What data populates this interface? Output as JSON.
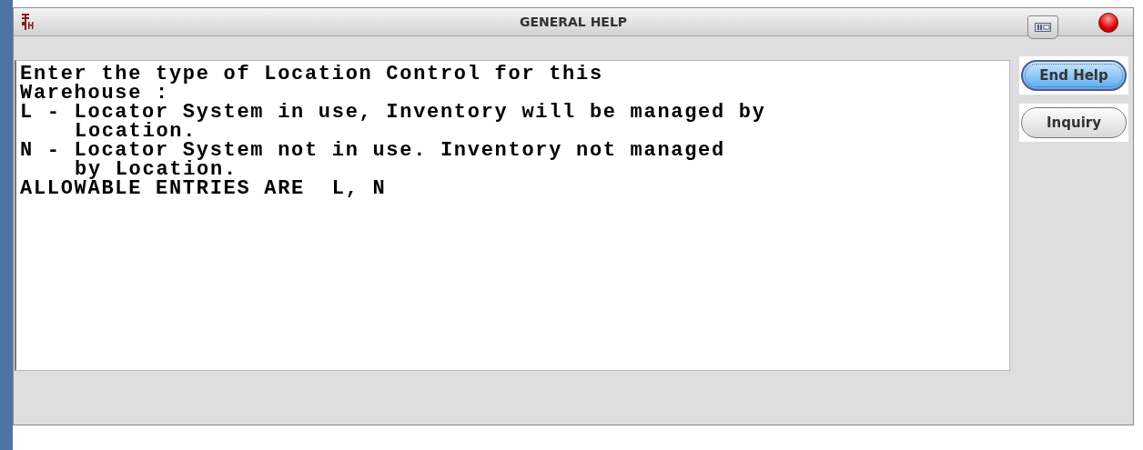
{
  "window": {
    "title": "GENERAL HELP"
  },
  "help_text": [
    {
      "text": "Enter the type of Location Control for this",
      "kind": "line"
    },
    {
      "text": "Warehouse :",
      "kind": "line"
    },
    {
      "text": "L - Locator System in use, Inventory will be managed by",
      "kind": "line"
    },
    {
      "text": "Location.",
      "kind": "continuation"
    },
    {
      "text": "N - Locator System not in use. Inventory not managed",
      "kind": "line"
    },
    {
      "text": "by Location.",
      "kind": "continuation"
    },
    {
      "text": "ALLOWABLE ENTRIES ARE  L, N",
      "kind": "line"
    }
  ],
  "buttons": [
    {
      "label": "End Help",
      "default": true
    },
    {
      "label": "Inquiry",
      "default": false
    }
  ]
}
